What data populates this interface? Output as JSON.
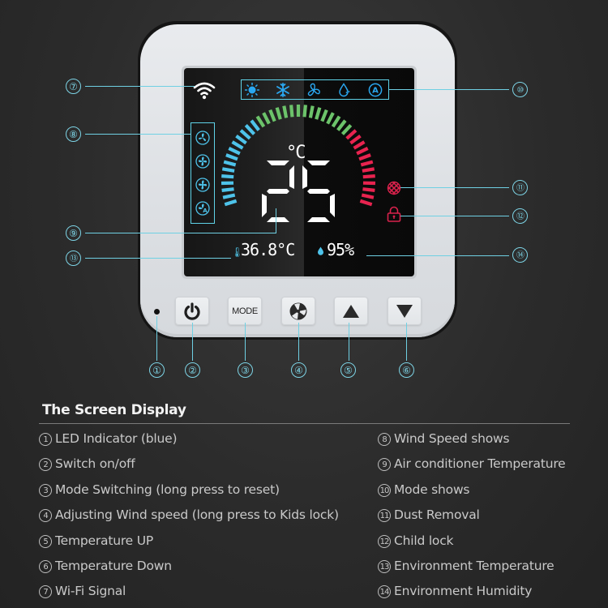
{
  "device": {
    "screen": {
      "setpoint_temperature": "25",
      "unit": "°C",
      "environment_temperature": "36.8°C",
      "environment_humidity": "95%",
      "modes": [
        "heat-sun",
        "cool-snowflake",
        "fan",
        "dry-droplet",
        "auto"
      ],
      "fan_speeds": [
        "low",
        "medium",
        "high",
        "auto"
      ],
      "gauge": {
        "blue_segments": 14,
        "green_segments": 15,
        "red_segments": 12
      },
      "colors": {
        "blue": "#4ec3ea",
        "green": "#6cc36a",
        "red": "#e8234f",
        "callout": "#6fd0e3"
      }
    },
    "buttons": {
      "power": "power",
      "mode_label": "MODE",
      "fan": "fan",
      "up": "up",
      "down": "down"
    }
  },
  "callouts": [
    "①",
    "②",
    "③",
    "④",
    "⑤",
    "⑥",
    "⑦",
    "⑧",
    "⑨",
    "⑩",
    "⑪",
    "⑫",
    "⑬",
    "⑭"
  ],
  "legend": {
    "title": "The Screen Display",
    "left": [
      {
        "num": "1",
        "text": "LED Indicator (blue)"
      },
      {
        "num": "2",
        "text": "Switch on/off"
      },
      {
        "num": "3",
        "text": "Mode Switching (long press to reset)"
      },
      {
        "num": "4",
        "text": "Adjusting Wind speed (long press to Kids lock)"
      },
      {
        "num": "5",
        "text": "Temperature UP"
      },
      {
        "num": "6",
        "text": "Temperature Down"
      },
      {
        "num": "7",
        "text": "Wi-Fi Signal"
      }
    ],
    "right": [
      {
        "num": "8",
        "text": "Wind Speed shows"
      },
      {
        "num": "9",
        "text": "Air conditioner Temperature"
      },
      {
        "num": "10",
        "text": "Mode shows"
      },
      {
        "num": "11",
        "text": "Dust Removal"
      },
      {
        "num": "12",
        "text": "Child lock"
      },
      {
        "num": "13",
        "text": "Environment Temperature"
      },
      {
        "num": "14",
        "text": "Environment Humidity"
      }
    ]
  }
}
